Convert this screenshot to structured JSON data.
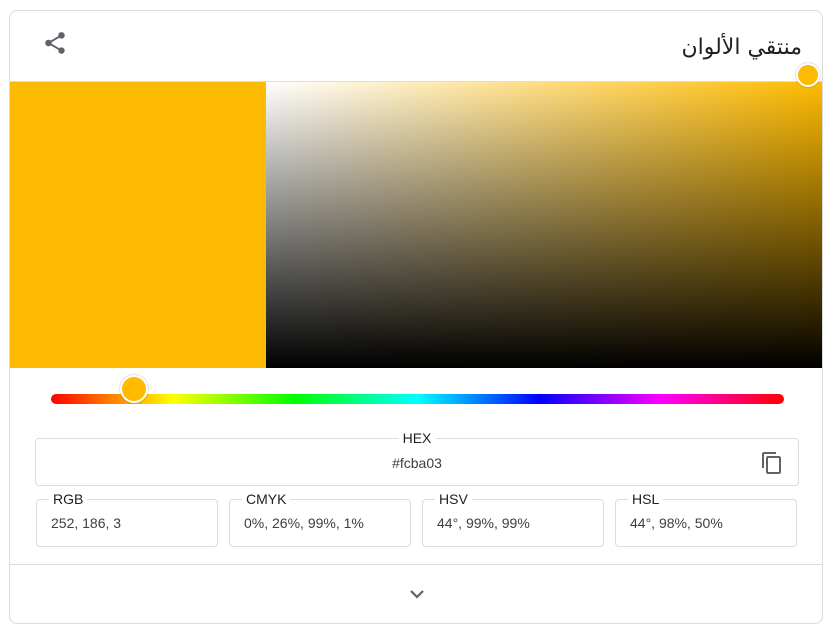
{
  "header": {
    "title": "منتقي الألوان",
    "share_icon": "share-icon"
  },
  "color": {
    "selected_hex": "#fcba03",
    "hue_hex": "#ffbb00",
    "saturation_percent": 99,
    "value_percent": 99,
    "hue_degrees": 44
  },
  "hex_field": {
    "label": "HEX",
    "value": "#fcba03",
    "copy_icon": "copy-icon"
  },
  "fields": [
    {
      "label": "RGB",
      "value": "252, 186, 3"
    },
    {
      "label": "CMYK",
      "value": "0%, 26%, 99%, 1%"
    },
    {
      "label": "HSV",
      "value": "44°, 99%, 99%"
    },
    {
      "label": "HSL",
      "value": "44°, 98%, 50%"
    }
  ],
  "footer": {
    "expand_icon": "chevron-down-icon"
  }
}
